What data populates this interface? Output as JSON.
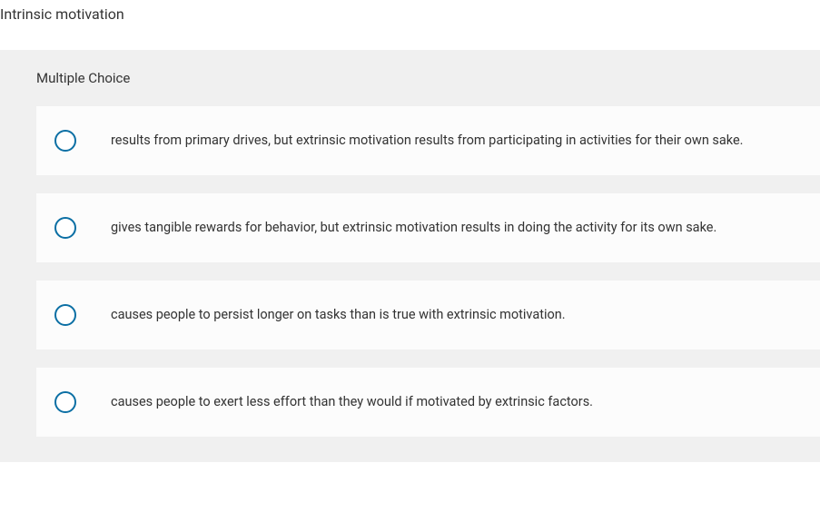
{
  "question": {
    "title": "Intrinsic motivation"
  },
  "section_label": "Multiple Choice",
  "options": [
    {
      "text": "results from primary drives, but extrinsic motivation results from participating in activities for their own sake."
    },
    {
      "text": "gives tangible rewards for behavior, but extrinsic motivation results in doing the activity for its own sake."
    },
    {
      "text": "causes people to persist longer on tasks than is true with extrinsic motivation."
    },
    {
      "text": "causes people to exert less effort than they would if motivated by extrinsic factors."
    }
  ]
}
